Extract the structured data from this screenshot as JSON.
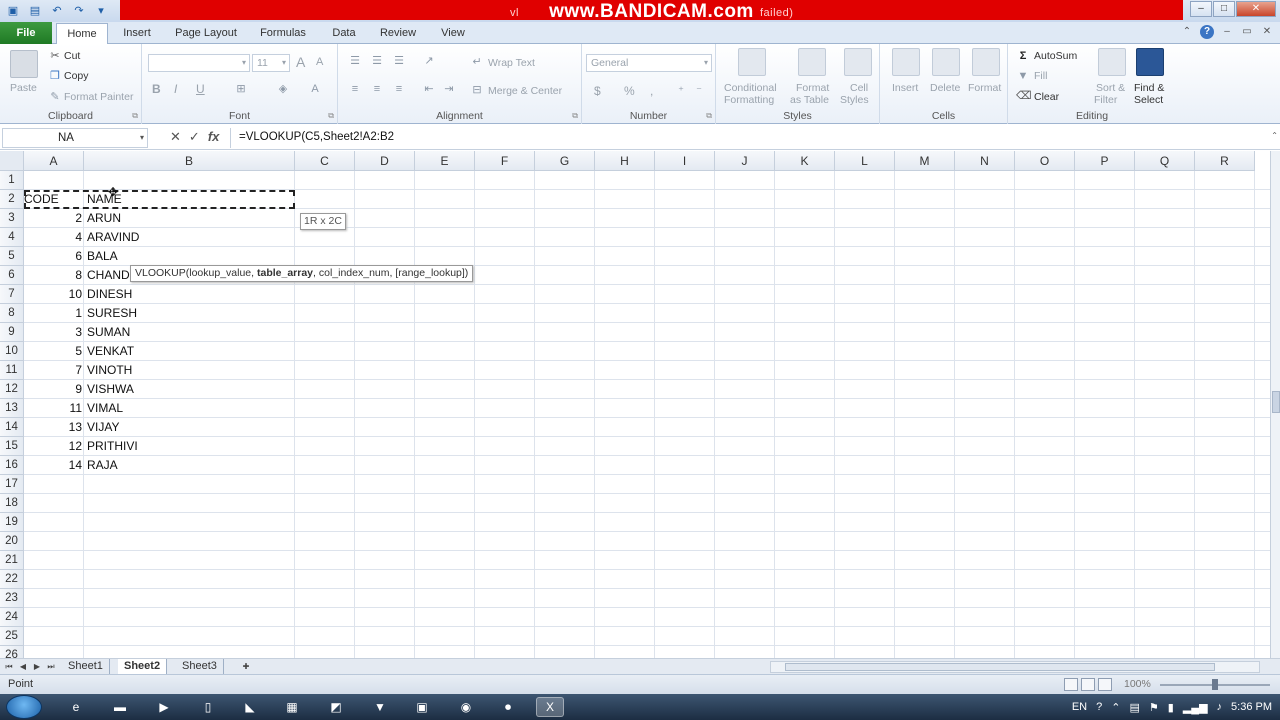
{
  "titlebar": {
    "overlay": "www.BANDICAM.com",
    "behind_left": "vl",
    "behind_right": "failed)"
  },
  "tabs": [
    "File",
    "Home",
    "Insert",
    "Page Layout",
    "Formulas",
    "Data",
    "Review",
    "View"
  ],
  "ribbon": {
    "clipboard": {
      "paste": "Paste",
      "cut": "Cut",
      "copy": "Copy",
      "format_painter": "Format Painter",
      "label": "Clipboard"
    },
    "font": {
      "size": "11",
      "label": "Font",
      "bold": "B",
      "italic": "I",
      "underline": "U",
      "grow": "A",
      "shrink": "A"
    },
    "alignment": {
      "wrap": "Wrap Text",
      "merge": "Merge & Center",
      "label": "Alignment"
    },
    "number": {
      "format": "General",
      "currency": "$",
      "percent": "%",
      "comma": ",",
      "label": "Number"
    },
    "styles": {
      "conditional": "Conditional",
      "conditional2": "Formatting",
      "format_table": "Format",
      "format_table2": "as Table",
      "cell_styles": "Cell",
      "cell_styles2": "Styles",
      "label": "Styles"
    },
    "cells": {
      "insert": "Insert",
      "delete": "Delete",
      "format": "Format",
      "label": "Cells"
    },
    "editing": {
      "autosum": "AutoSum",
      "fill": "Fill",
      "clear": "Clear",
      "sort": "Sort &",
      "sort2": "Filter",
      "find": "Find &",
      "find2": "Select",
      "label": "Editing"
    }
  },
  "formulabar": {
    "namebox": "NA",
    "formula": "=VLOOKUP(C5,Sheet2!A2:B2"
  },
  "columns": [
    "A",
    "B",
    "C",
    "D",
    "E",
    "F",
    "G",
    "H",
    "I",
    "J",
    "K",
    "L",
    "M",
    "N",
    "O",
    "P",
    "Q",
    "R"
  ],
  "rows": [
    "1",
    "2",
    "3",
    "4",
    "5",
    "6",
    "7",
    "8",
    "9",
    "10",
    "11",
    "12",
    "13",
    "14",
    "15",
    "16",
    "17",
    "18",
    "19",
    "20",
    "21",
    "22",
    "23",
    "24",
    "25",
    "26"
  ],
  "cells": {
    "header_code": "CODE",
    "header_name": "NAME",
    "data": [
      {
        "code": "2",
        "name": "ARUN"
      },
      {
        "code": "4",
        "name": "ARAVIND"
      },
      {
        "code": "6",
        "name": "BALA"
      },
      {
        "code": "8",
        "name": "CHAND"
      },
      {
        "code": "10",
        "name": "DINESH"
      },
      {
        "code": "1",
        "name": "SURESH"
      },
      {
        "code": "3",
        "name": "SUMAN"
      },
      {
        "code": "5",
        "name": "VENKAT"
      },
      {
        "code": "7",
        "name": "VINOTH"
      },
      {
        "code": "9",
        "name": "VISHWA"
      },
      {
        "code": "11",
        "name": "VIMAL"
      },
      {
        "code": "13",
        "name": "VIJAY"
      },
      {
        "code": "12",
        "name": "PRITHIVI"
      },
      {
        "code": "14",
        "name": "RAJA"
      }
    ]
  },
  "range_hint": "1R x 2C",
  "tooltip": {
    "fn": "VLOOKUP(lookup_value, ",
    "bold": "table_array",
    "rest": ", col_index_num, [range_lookup])"
  },
  "sheets": [
    "Sheet1",
    "Sheet2",
    "Sheet3"
  ],
  "active_sheet": "Sheet2",
  "status": {
    "mode": "Point",
    "zoom": "100%"
  },
  "tray": {
    "lang": "EN",
    "time": "5:36 PM"
  },
  "colors": {
    "file_tab": "#1f7a24",
    "bandicam": "#e00000",
    "taskbar": "#1c2d42"
  }
}
